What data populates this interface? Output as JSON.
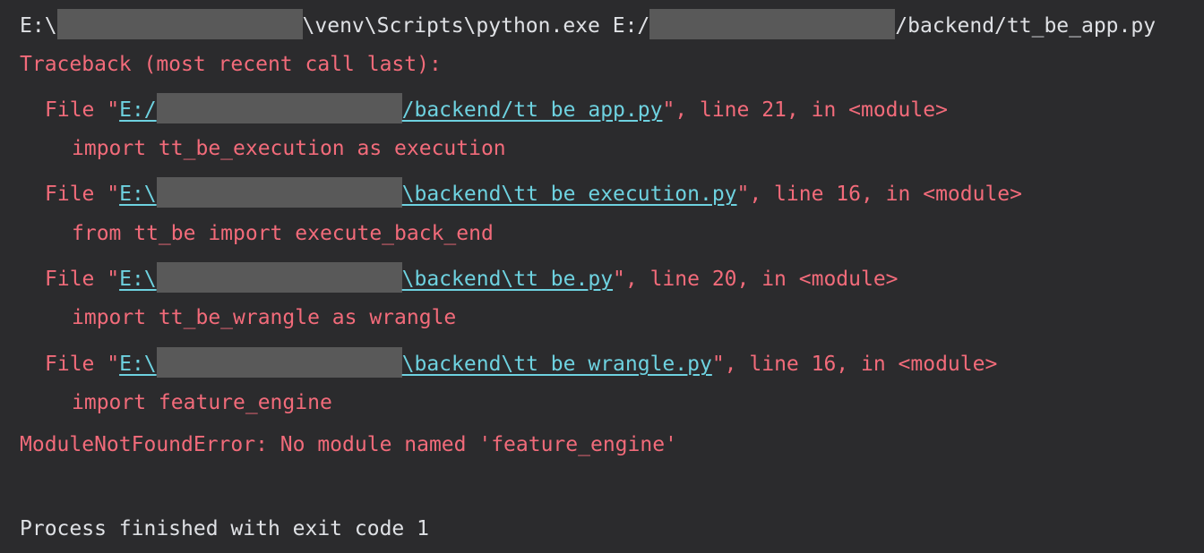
{
  "command": {
    "prefix": "E:\\",
    "middle": "\\venv\\Scripts\\python.exe E:/",
    "suffix": "/backend/tt_be_app.py"
  },
  "traceback_header": "Traceback (most recent call last):",
  "frames": [
    {
      "file_label": "File \"",
      "path_start": "E:/",
      "path_end": "/backend/tt_be_app.py",
      "after": "\", line 21, in <module>",
      "code": "import tt_be_execution as execution"
    },
    {
      "file_label": "File \"",
      "path_start": "E:\\",
      "path_end": "\\backend\\tt_be_execution.py",
      "after": "\", line 16, in <module>",
      "code": "from tt_be import execute_back_end"
    },
    {
      "file_label": "File \"",
      "path_start": "E:\\",
      "path_end": "\\backend\\tt_be.py",
      "after": "\", line 20, in <module>",
      "code": "import tt_be_wrangle as wrangle"
    },
    {
      "file_label": "File \"",
      "path_start": "E:\\",
      "path_end": "\\backend\\tt_be_wrangle.py",
      "after": "\", line 16, in <module>",
      "code": "import feature_engine"
    }
  ],
  "error": "ModuleNotFoundError: No module named 'feature_engine'",
  "exit_message": "Process finished with exit code 1",
  "colors": {
    "background": "#2b2b2d",
    "text": "#dfe1e5",
    "error": "#f26b7a",
    "link": "#6ed2e0",
    "redaction": "#595959"
  }
}
